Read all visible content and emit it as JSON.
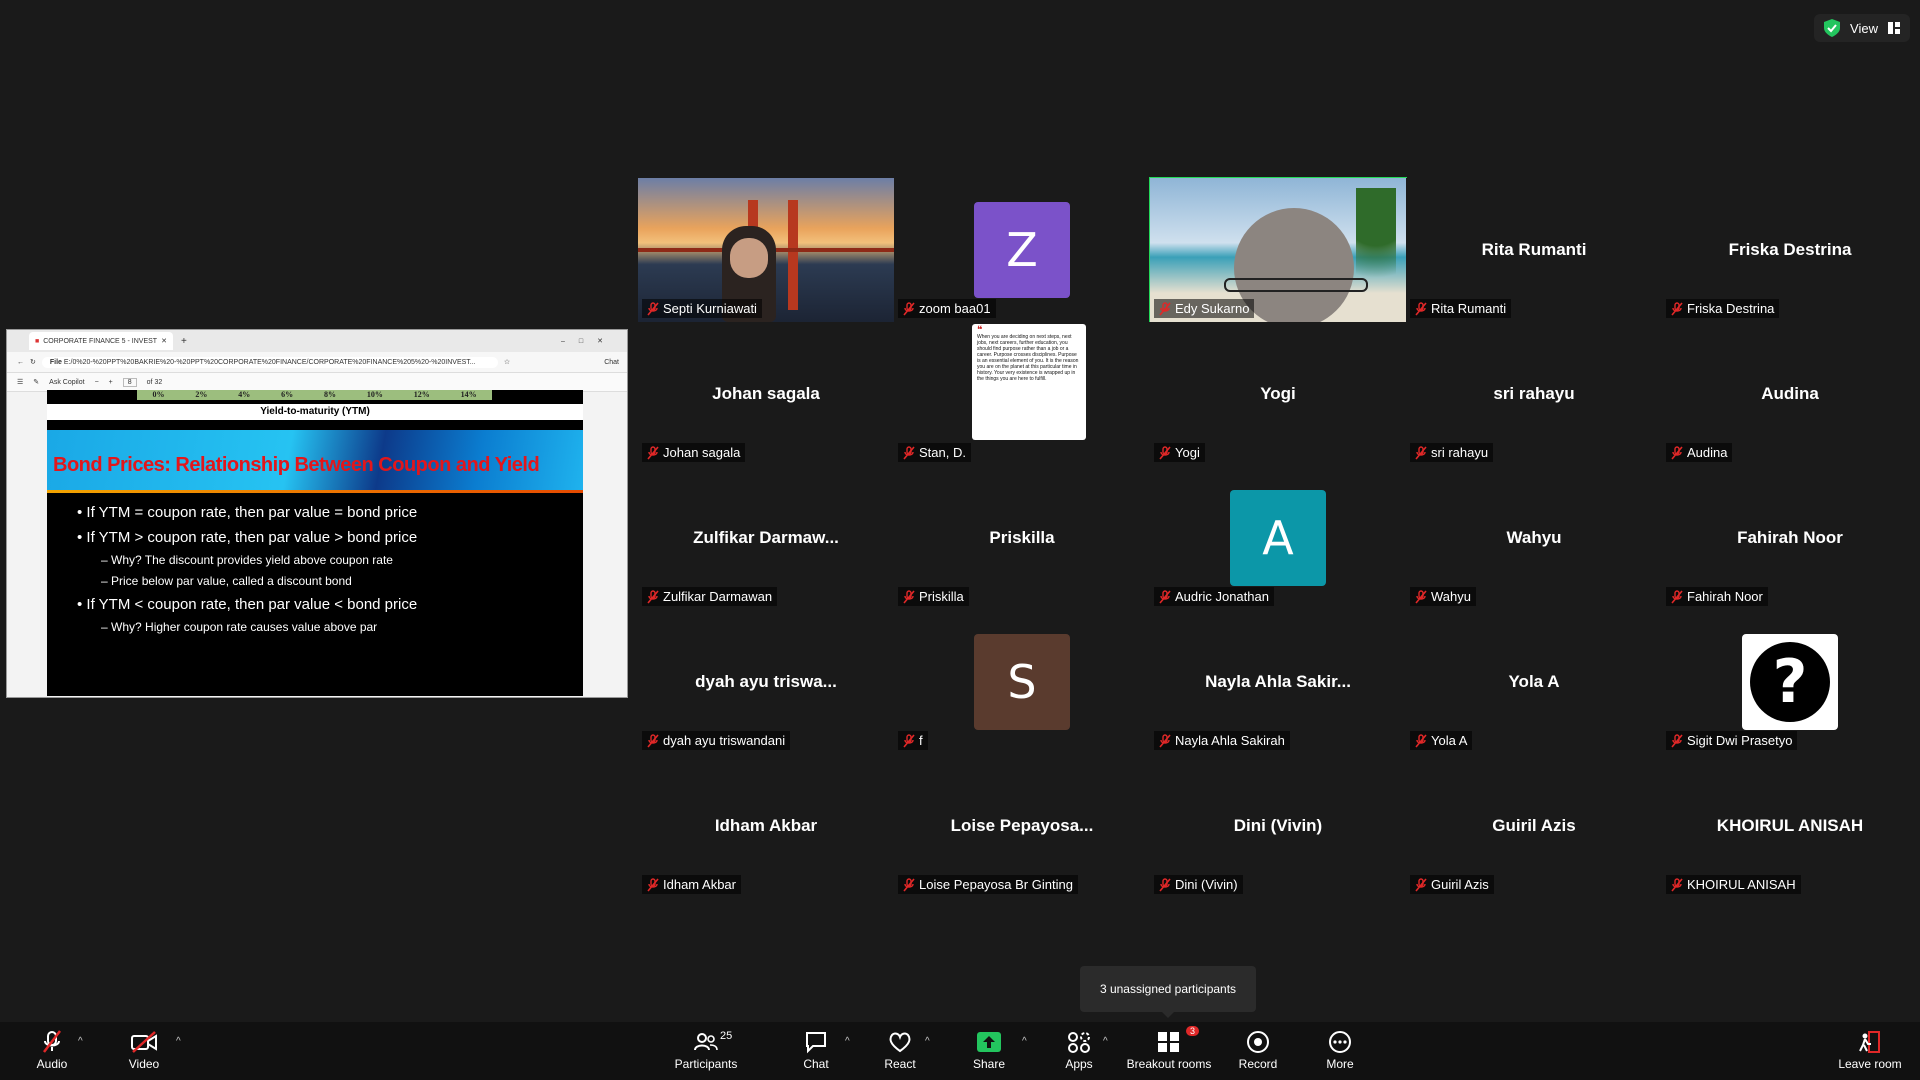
{
  "view_button": {
    "label": "View"
  },
  "shared_screen": {
    "tab_title": "CORPORATE FINANCE 5 - INVEST",
    "url_prefix": "File",
    "url": "E:/0%20-%20PPT%20BAKRIE%20-%20PPT%20CORPORATE%20FINANCE/CORPORATE%20FINANCE%205%20-%20INVEST...",
    "toolbar": {
      "ask_copilot": "Ask Copilot",
      "page": "8",
      "of_pages": "of 32",
      "chat": "Chat"
    },
    "axis_ticks": [
      "0%",
      "2%",
      "4%",
      "6%",
      "8%",
      "10%",
      "12%",
      "14%"
    ],
    "axis_label": "Yield-to-maturity (YTM)",
    "slide_title": "Bond Prices: Relationship Between Coupon and Yield",
    "bullets": [
      {
        "level": 1,
        "text": "If YTM = coupon rate, then par value = bond price"
      },
      {
        "level": 1,
        "text": "If YTM > coupon rate, then par value > bond price"
      },
      {
        "level": 2,
        "text": "Why? The discount provides yield above coupon rate"
      },
      {
        "level": 2,
        "text": "Price below par value, called a discount bond"
      },
      {
        "level": 1,
        "text": "If YTM < coupon rate, then par value < bond price"
      },
      {
        "level": 2,
        "text": "Why? Higher coupon rate causes value above par"
      }
    ]
  },
  "participants": [
    {
      "big": "",
      "tag": "Septi Kurniawati",
      "kind": "video-bridge"
    },
    {
      "big": "",
      "tag": "zoom baa01",
      "kind": "avatar",
      "letter": "Z",
      "color": "#7b52c9"
    },
    {
      "big": "",
      "tag": "Edy Sukarno",
      "kind": "video-beach",
      "active": true
    },
    {
      "big": "Rita Rumanti",
      "tag": "Rita Rumanti"
    },
    {
      "big": "Friska Destrina",
      "tag": "Friska Destrina"
    },
    {
      "big": "Johan sagala",
      "tag": "Johan sagala"
    },
    {
      "big": "",
      "tag": "Stan, D.",
      "kind": "quote",
      "quote": "When you are deciding on next steps, next jobs, next careers, further education, you should find purpose rather than a job or a career. Purpose crosses disciplines. Purpose is an essential element of you. It is the reason you are on the planet at this particular time in history. Your very existence is wrapped up in the things you are here to fulfill."
    },
    {
      "big": "Yogi",
      "tag": "Yogi"
    },
    {
      "big": "sri rahayu",
      "tag": "sri rahayu"
    },
    {
      "big": "Audina",
      "tag": "Audina"
    },
    {
      "big": "Zulfikar  Darmaw...",
      "tag": "Zulfikar Darmawan"
    },
    {
      "big": "Priskilla",
      "tag": "Priskilla"
    },
    {
      "big": "",
      "tag": "Audric Jonathan",
      "kind": "avatar",
      "letter": "A",
      "color": "#0c97a8"
    },
    {
      "big": "Wahyu",
      "tag": "Wahyu"
    },
    {
      "big": "Fahirah Noor",
      "tag": "Fahirah Noor"
    },
    {
      "big": "dyah ayu triswa...",
      "tag": "dyah ayu triswandani"
    },
    {
      "big": "",
      "tag": "f",
      "kind": "avatar",
      "letter": "S",
      "color": "#5a3b2e"
    },
    {
      "big": "Nayla  Ahla  Sakir...",
      "tag": "Nayla Ahla Sakirah"
    },
    {
      "big": "Yola A",
      "tag": "Yola A"
    },
    {
      "big": "",
      "tag": "Sigit Dwi Prasetyo",
      "kind": "question"
    },
    {
      "big": "Idham Akbar",
      "tag": "Idham Akbar"
    },
    {
      "big": "Loise  Pepayosa...",
      "tag": "Loise Pepayosa Br Ginting"
    },
    {
      "big": "Dini (Vivin)",
      "tag": "Dini (Vivin)"
    },
    {
      "big": "Guiril Azis",
      "tag": "Guiril Azis"
    },
    {
      "big": "KHOIRUL ANISAH",
      "tag": "KHOIRUL ANISAH"
    }
  ],
  "tooltip": "3 unassigned participants",
  "toolbar": {
    "audio": "Audio",
    "video": "Video",
    "participants": "Participants",
    "participants_count": "25",
    "chat": "Chat",
    "react": "React",
    "share": "Share",
    "apps": "Apps",
    "breakout": "Breakout rooms",
    "breakout_badge": "3",
    "record": "Record",
    "more": "More",
    "leave": "Leave room"
  }
}
